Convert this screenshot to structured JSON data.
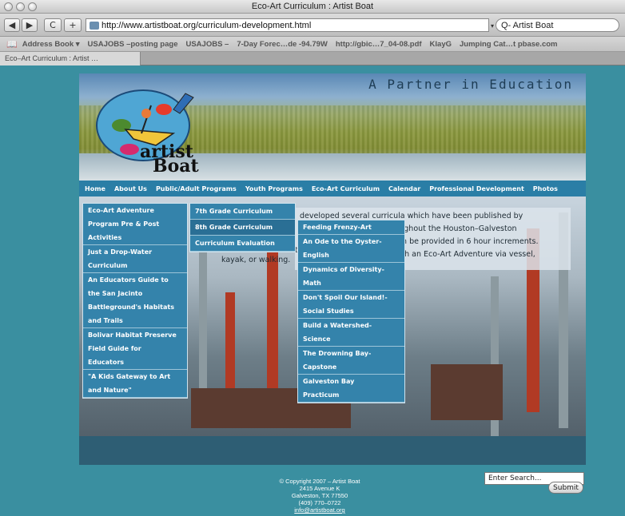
{
  "window": {
    "title": "Eco-Art Curriculum : Artist Boat"
  },
  "toolbar": {
    "back_icon": "◀",
    "forward_icon": "▶",
    "reload_icon": "C",
    "add_icon": "+",
    "url": "http://www.artistboat.org/curriculum-development.html",
    "search_value": "Q- Artist Boat"
  },
  "bookmarks": [
    "Address Book ▾",
    "USAJOBS –posting page",
    "USAJOBS –",
    "7-Day Forec…de -94.79W",
    "http://gbic…7_04-08.pdf",
    "KlayG",
    "Jumping Cat…t pbase.com"
  ],
  "tab": {
    "label": "Eco–Art Curriculum : Artist …"
  },
  "header": {
    "tagline": "A Partner in Education",
    "logo_line1": "artist",
    "logo_line2": "Boat"
  },
  "nav": [
    "Home",
    "About Us",
    "Public/Adult Programs",
    "Youth Programs",
    "Eco-Art Curriculum",
    "Calendar",
    "Professional Development",
    "Photos"
  ],
  "body_text": {
    "line1": "developed  several  curricula  which  have  been  published  by",
    "line2": "throughout  the  Houston–Galveston",
    "line3": "can  be  provided  in  6  hour  increments.",
    "line4": "it  is  recommended  the",
    "line5": "with  an  Eco-Art  Adventure  via  vessel,",
    "line6": "kayak,  or  walking."
  },
  "menu1": [
    "Eco-Art Adventure",
    "Program Pre & Post",
    "Activities",
    "Just a Drop-Water",
    "Curriculum",
    "An Educators Guide to",
    "the San Jacinto",
    "Battleground's Habitats",
    "and Trails",
    "Bolivar Habitat Preserve",
    "Field Guide for",
    "Educators",
    "\"A Kids Gateway to Art",
    "and Nature\""
  ],
  "menu2": [
    "7th Grade Curriculum",
    "8th Grade Curriculum",
    "Curriculum Evaluation"
  ],
  "menu3": [
    "Feeding Frenzy-Art",
    "An Ode to the Oyster-",
    "English",
    "Dynamics of Diversity-",
    "Math",
    "Don't Spoil Our Island!-",
    "Social Studies",
    "Build a Watershed-",
    "Science",
    "The Drowning Bay-",
    "Capstone",
    "Galveston Bay",
    "Practicum"
  ],
  "footer": {
    "line1": "© Copyright 2007 – Artist Boat",
    "line2": "2415 Avenue K",
    "line3": "Galveston, TX 77550",
    "line4": "(409) 770–0722",
    "line5": "info@artistboat.org",
    "search_placeholder": "Enter Search...",
    "submit_label": "Submit"
  }
}
